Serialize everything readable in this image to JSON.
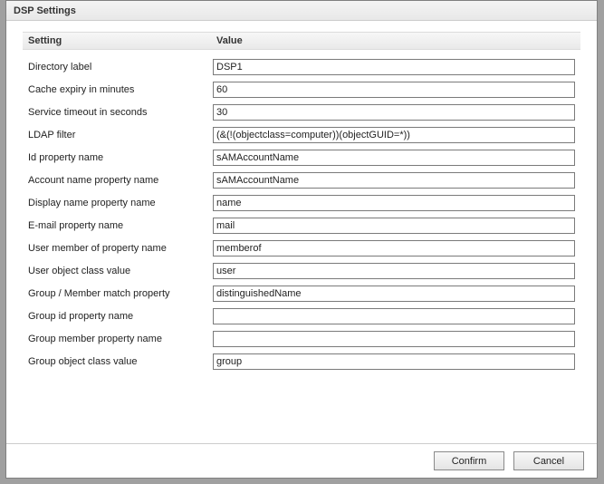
{
  "dialog": {
    "title": "DSP Settings"
  },
  "columns": {
    "setting": "Setting",
    "value": "Value"
  },
  "settings": [
    {
      "label": "Directory label",
      "value": "DSP1"
    },
    {
      "label": "Cache expiry in minutes",
      "value": "60"
    },
    {
      "label": "Service timeout in seconds",
      "value": "30"
    },
    {
      "label": "LDAP filter",
      "value": "(&(!(objectclass=computer))(objectGUID=*))"
    },
    {
      "label": "Id property name",
      "value": "sAMAccountName"
    },
    {
      "label": "Account name property name",
      "value": "sAMAccountName"
    },
    {
      "label": "Display name property name",
      "value": "name"
    },
    {
      "label": "E-mail property name",
      "value": "mail"
    },
    {
      "label": "User member of property name",
      "value": "memberof"
    },
    {
      "label": "User object class value",
      "value": "user"
    },
    {
      "label": "Group / Member match property",
      "value": "distinguishedName"
    },
    {
      "label": "Group id property name",
      "value": ""
    },
    {
      "label": "Group member property name",
      "value": ""
    },
    {
      "label": "Group object class value",
      "value": "group"
    }
  ],
  "buttons": {
    "confirm": "Confirm",
    "cancel": "Cancel"
  }
}
